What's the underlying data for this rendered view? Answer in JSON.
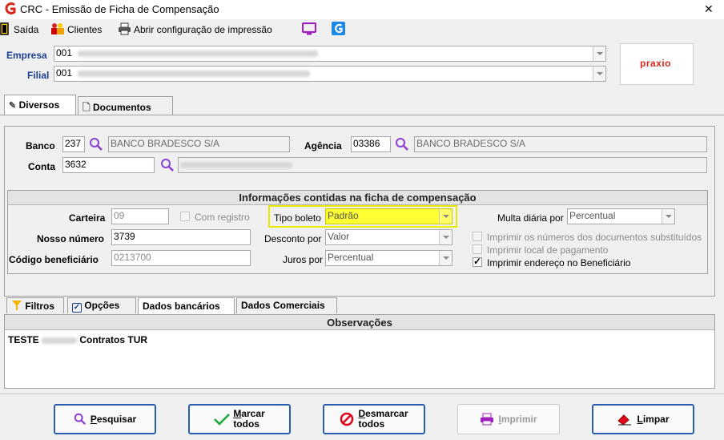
{
  "window": {
    "title": "CRC - Emissão de Ficha de Compensação",
    "close_glyph": "✕"
  },
  "toolbar": {
    "saida": "Saída",
    "clientes": "Clientes",
    "abrir_config": "Abrir configuração de impressão"
  },
  "header": {
    "empresa_label": "Empresa",
    "empresa_code": "001",
    "filial_label": "Filial",
    "filial_code": "001",
    "logo_text": "praxio"
  },
  "main_tabs": [
    {
      "label": "Diversos"
    },
    {
      "label": "Documentos"
    }
  ],
  "bank": {
    "banco_label": "Banco",
    "banco_code": "237",
    "banco_name": "BANCO BRADESCO S/A",
    "agencia_label": "Agência",
    "agencia_code": "03386",
    "agencia_name": "BANCO BRADESCO S/A",
    "conta_label": "Conta",
    "conta_code": "3632"
  },
  "ficha": {
    "header": "Informações contidas na ficha de compensação",
    "carteira_label": "Carteira",
    "carteira_value": "09",
    "com_registro_label": "Com registro",
    "tipo_boleto_label": "Tipo boleto",
    "tipo_boleto_value": "Padrão",
    "multa_label": "Multa diária por",
    "multa_value": "Percentual",
    "nosso_numero_label": "Nosso número",
    "nosso_numero_value": "3739",
    "desconto_label": "Desconto por",
    "desconto_value": "Valor",
    "codigo_benef_label": "Código beneficiário",
    "codigo_benef_value": "0213700",
    "juros_label": "Juros por",
    "juros_value": "Percentual",
    "opt_numeros": "Imprimir os números dos documentos substituídos",
    "opt_local": "Imprimir local de pagamento",
    "opt_endereco": "Imprimir endereço no Beneficiário",
    "opt_endereco_checked": true
  },
  "sub_tabs": [
    {
      "label": "Filtros"
    },
    {
      "label": "Opções"
    },
    {
      "label": "Dados bancários"
    },
    {
      "label": "Dados Comerciais"
    }
  ],
  "observacoes": {
    "header": "Observações",
    "text_start": "TESTE",
    "text_end": "Contratos TUR"
  },
  "buttons": {
    "pesquisar": {
      "key": "P",
      "rest": "esquisar"
    },
    "marcar": {
      "key": "M",
      "line1_rest": "arcar",
      "line2": "todos"
    },
    "desmarcar": {
      "key": "D",
      "line1_rest": "esmarcar",
      "line2": "todos"
    },
    "imprimir": {
      "key": "I",
      "rest": "mprimir"
    },
    "limpar": {
      "key": "L",
      "rest": "impar"
    }
  },
  "colors": {
    "highlight": "#ffff33",
    "highlight_border": "#c8c800",
    "accent": "#2a5db0",
    "app_red": "#d9261c"
  }
}
